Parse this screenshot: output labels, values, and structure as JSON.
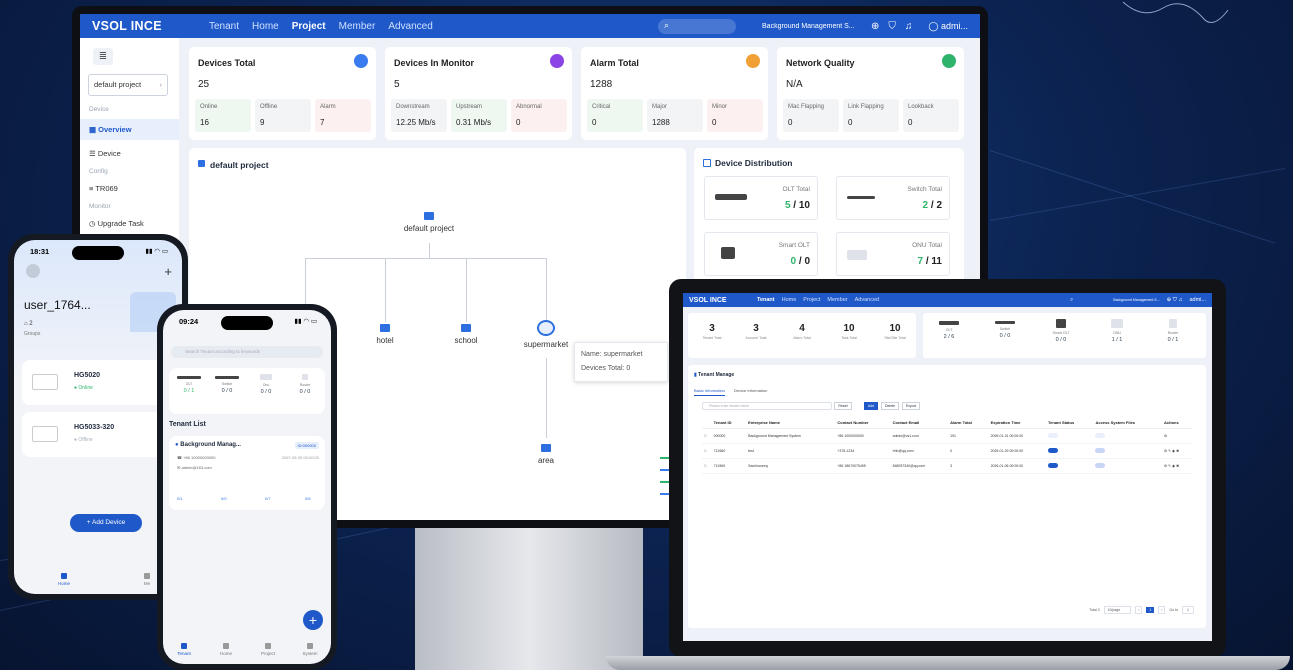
{
  "desktop": {
    "logo": "VSOL INCE",
    "nav": [
      "Tenant",
      "Home",
      "Project",
      "Member",
      "Advanced"
    ],
    "nav_active_index": 2,
    "org": "Background Management S...",
    "user": "admi...",
    "sidebar": {
      "project": "default project",
      "group_device": "Device",
      "overview": "Overview",
      "device": "Device",
      "group_config": "Config",
      "tr069": "TR069",
      "group_monitor": "Monitor",
      "upgrade": "Upgrade Task"
    },
    "cards": [
      {
        "title": "Devices Total",
        "total": "25",
        "color": "#3b7bf0",
        "subs": [
          {
            "label": "Online",
            "value": "16"
          },
          {
            "label": "Offline",
            "value": "9"
          },
          {
            "label": "Alarm",
            "value": "7"
          }
        ]
      },
      {
        "title": "Devices In Monitor",
        "total": "5",
        "color": "#8b44e6",
        "subs": [
          {
            "label": "Downstream",
            "value": "12.25 Mb/s"
          },
          {
            "label": "Upstream",
            "value": "0.31 Mb/s"
          },
          {
            "label": "Abnormal",
            "value": "0"
          }
        ]
      },
      {
        "title": "Alarm Total",
        "total": "1288",
        "color": "#f0a035",
        "subs": [
          {
            "label": "Critical",
            "value": "0"
          },
          {
            "label": "Major",
            "value": "1288"
          },
          {
            "label": "Minor",
            "value": "0"
          }
        ]
      },
      {
        "title": "Network Quality",
        "total": "N/A",
        "color": "#2db36a",
        "subs": [
          {
            "label": "Mac Flapping",
            "value": "0"
          },
          {
            "label": "Link Flapping",
            "value": "0"
          },
          {
            "label": "Lookback",
            "value": "0"
          }
        ]
      }
    ],
    "topology": {
      "title": "default project",
      "root": "default project",
      "children": [
        "hotel",
        "school",
        "supermarket"
      ],
      "leaf": "area",
      "tooltip": {
        "name_label": "Name:",
        "name": "supermarket",
        "count_label": "Devices Total:",
        "count": "0"
      }
    },
    "distribution": {
      "title": "Device Distribution",
      "items": [
        {
          "label": "OLT Total",
          "online": "5",
          "total": "10"
        },
        {
          "label": "Switch Total",
          "online": "2",
          "total": "2"
        },
        {
          "label": "Smart OLT",
          "online": "0",
          "total": "0"
        },
        {
          "label": "ONU Total",
          "online": "7",
          "total": "11"
        }
      ]
    }
  },
  "laptop": {
    "logo": "VSOL INCE",
    "nav": [
      "Tenant",
      "Home",
      "Project",
      "Member",
      "Advanced"
    ],
    "org": "Background Management S...",
    "user": "admi...",
    "stats": [
      {
        "value": "3",
        "label": "Tenant Total"
      },
      {
        "value": "3",
        "label": "Account Total"
      },
      {
        "value": "4",
        "label": "Alarm Total"
      },
      {
        "value": "10",
        "label": "Task Total"
      },
      {
        "value": "10",
        "label": "Site/Site Total"
      }
    ],
    "devices": [
      {
        "label": "OLT",
        "value": "2 / 6"
      },
      {
        "label": "Switch",
        "value": "0 / 0"
      },
      {
        "label": "Smart OLT",
        "value": "0 / 0"
      },
      {
        "label": "ONU",
        "value": "1 / 1"
      },
      {
        "label": "Router",
        "value": "0 / 1"
      }
    ],
    "section_title": "Tenant Manage",
    "tabs": [
      "Basic Information",
      "Device Information"
    ],
    "search_placeholder": "Please enter tenant name",
    "buttons": {
      "reset": "Reset",
      "add": "Add",
      "delete": "Delete",
      "export": "Export"
    },
    "columns": [
      "Tenant ID",
      "Enterprise Name",
      "Contact Number",
      "Contact Email",
      "Alarm Total",
      "Expiration Time",
      "Tenant Status",
      "Access System Files",
      "Actions"
    ],
    "rows": [
      {
        "id": "000000",
        "name": "Background Management System",
        "phone": "+86 1000000000",
        "email": "admin@vs1.com",
        "alarm": "191",
        "exp": "2099-01-31 00:00:00",
        "status": false,
        "files": false
      },
      {
        "id": "712660",
        "name": "test",
        "phone": "+375-1234",
        "email": "hhh@qq.com",
        "alarm": "0",
        "exp": "2025-01-29 00:00:00",
        "status": true,
        "files": false
      },
      {
        "id": "711969",
        "name": "Sachinconny",
        "phone": "+86 18670075495",
        "email": "848937340@qq.com",
        "alarm": "3",
        "exp": "2026-01-06 00:00:00",
        "status": true,
        "files": false
      }
    ],
    "pagination": {
      "total": "Total 3",
      "per_page": "10/page",
      "page": "1",
      "goto": "Go to",
      "goto_value": "1"
    }
  },
  "phone_left": {
    "time": "18:31",
    "user": "user_1764...",
    "groups_count": "2",
    "groups_label": "Groups",
    "devices": [
      {
        "name": "HG5020",
        "status": "Online",
        "color": "#2db36a"
      },
      {
        "name": "HG5033-320",
        "status": "Offline",
        "color": "#aab2bf"
      }
    ],
    "add_button": "+ Add Device",
    "tabs": [
      "Home",
      "Me"
    ]
  },
  "phone_right": {
    "time": "09:24",
    "search_placeholder": "Search Tenant according to keywords",
    "devices": [
      {
        "label": "OLT",
        "value": "0 / 1"
      },
      {
        "label": "Switch",
        "value": "0 / 0"
      },
      {
        "label": "Onu",
        "value": "0 / 0"
      },
      {
        "label": "Router",
        "value": "0 / 0"
      }
    ],
    "list_title": "Tenant List",
    "tenant": {
      "name": "Background Manag...",
      "id": "ID:000000",
      "phone": "+86 10000000000",
      "date": "2097-09-30 00:00:00",
      "email": "admin@163.com"
    },
    "counts": [
      "0/1",
      "0/0",
      "0/7",
      "0/6"
    ],
    "tabs": [
      "Tenant",
      "Home",
      "Project",
      "System"
    ]
  }
}
